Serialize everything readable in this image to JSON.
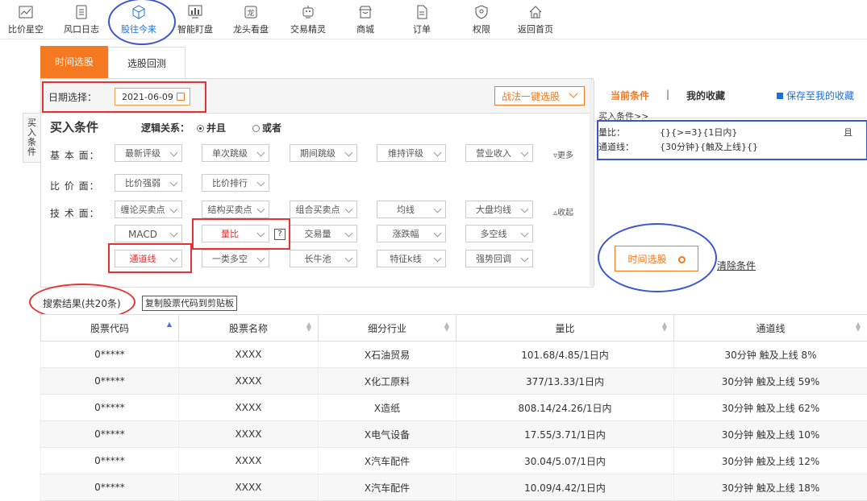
{
  "nav": {
    "items": [
      {
        "label": "比价星空",
        "icon": "line-chart-icon"
      },
      {
        "label": "风口日志",
        "icon": "document-icon"
      },
      {
        "label": "股往今来",
        "icon": "cube-icon"
      },
      {
        "label": "智能盯盘",
        "icon": "bar-chart-icon"
      },
      {
        "label": "龙头看盘",
        "icon": "dragon-icon"
      },
      {
        "label": "交易精灵",
        "icon": "robot-icon"
      },
      {
        "label": "商城",
        "icon": "shop-icon"
      },
      {
        "label": "订单",
        "icon": "order-icon"
      },
      {
        "label": "权限",
        "icon": "shield-icon"
      },
      {
        "label": "返回首页",
        "icon": "home-icon"
      }
    ]
  },
  "tabs": {
    "time_select": "时间选股",
    "backtest": "选股回测"
  },
  "date": {
    "label": "日期选择：",
    "value": "2021-06-09"
  },
  "one_click": "战法一键选股",
  "side_tab": "买入条件",
  "buy": {
    "title": "买入条件",
    "logic_label": "逻辑关系：",
    "and": "并且",
    "or": "或者"
  },
  "rows": {
    "basic": {
      "label": "基 本 面：",
      "items": [
        "最新评级",
        "单次跳级",
        "期间跳级",
        "维持评级",
        "营业收入"
      ],
      "more": "更多"
    },
    "price": {
      "label": "比 价 面：",
      "items": [
        "比价强弱",
        "比价排行"
      ]
    },
    "tech": {
      "label": "技 术 面：",
      "row1": [
        "缠论买卖点",
        "结构买卖点",
        "组合买卖点",
        "均线",
        "大盘均线"
      ],
      "collapse": "收起",
      "row2": [
        "MACD",
        "量比",
        "交易量",
        "涨跌幅",
        "多空线"
      ],
      "row3": [
        "通道线",
        "一类多空",
        "长牛池",
        "特征k线",
        "强势回调"
      ],
      "help": "?"
    }
  },
  "right": {
    "tab_current": "当前条件",
    "sep": "|",
    "tab_fav": "我的收藏",
    "save": "保存至我的收藏",
    "buy_cond": "买入条件>>",
    "c1_name": "量比：",
    "c1_val": "{}{>=3}{1日内}",
    "c1_tail": "且",
    "c2_name": "通道线：",
    "c2_val": "{30分钟}{触及上线}{}",
    "time_btn": "时间选股",
    "clear": "清除条件"
  },
  "results": {
    "title": "搜索结果(共20条)",
    "copy": "复制股票代码到剪贴板",
    "headers": [
      "股票代码",
      "股票名称",
      "细分行业",
      "量比",
      "通道线"
    ],
    "rows": [
      [
        "0*****",
        "XXXX",
        "X石油贸易",
        "101.68/4.85/1日内",
        "30分钟 触及上线 8%"
      ],
      [
        "0*****",
        "XXXX",
        "X化工原料",
        "377/13.33/1日内",
        "30分钟 触及上线 59%"
      ],
      [
        "0*****",
        "XXXX",
        "X造纸",
        "808.14/24.26/1日内",
        "30分钟 触及上线 62%"
      ],
      [
        "0*****",
        "XXXX",
        "X电气设备",
        "17.55/3.71/1日内",
        "30分钟 触及上线 10%"
      ],
      [
        "0*****",
        "XXXX",
        "X汽车配件",
        "30.04/5.07/1日内",
        "30分钟 触及上线 12%"
      ],
      [
        "0*****",
        "XXXX",
        "X汽车配件",
        "10.09/4.42/1日内",
        "30分钟 触及上线 18%"
      ]
    ]
  },
  "colors": {
    "accent": "#f47920",
    "annotation_red": "#e53333",
    "annotation_blue": "#3b55d1",
    "active_nav": "#1e6fd9"
  }
}
